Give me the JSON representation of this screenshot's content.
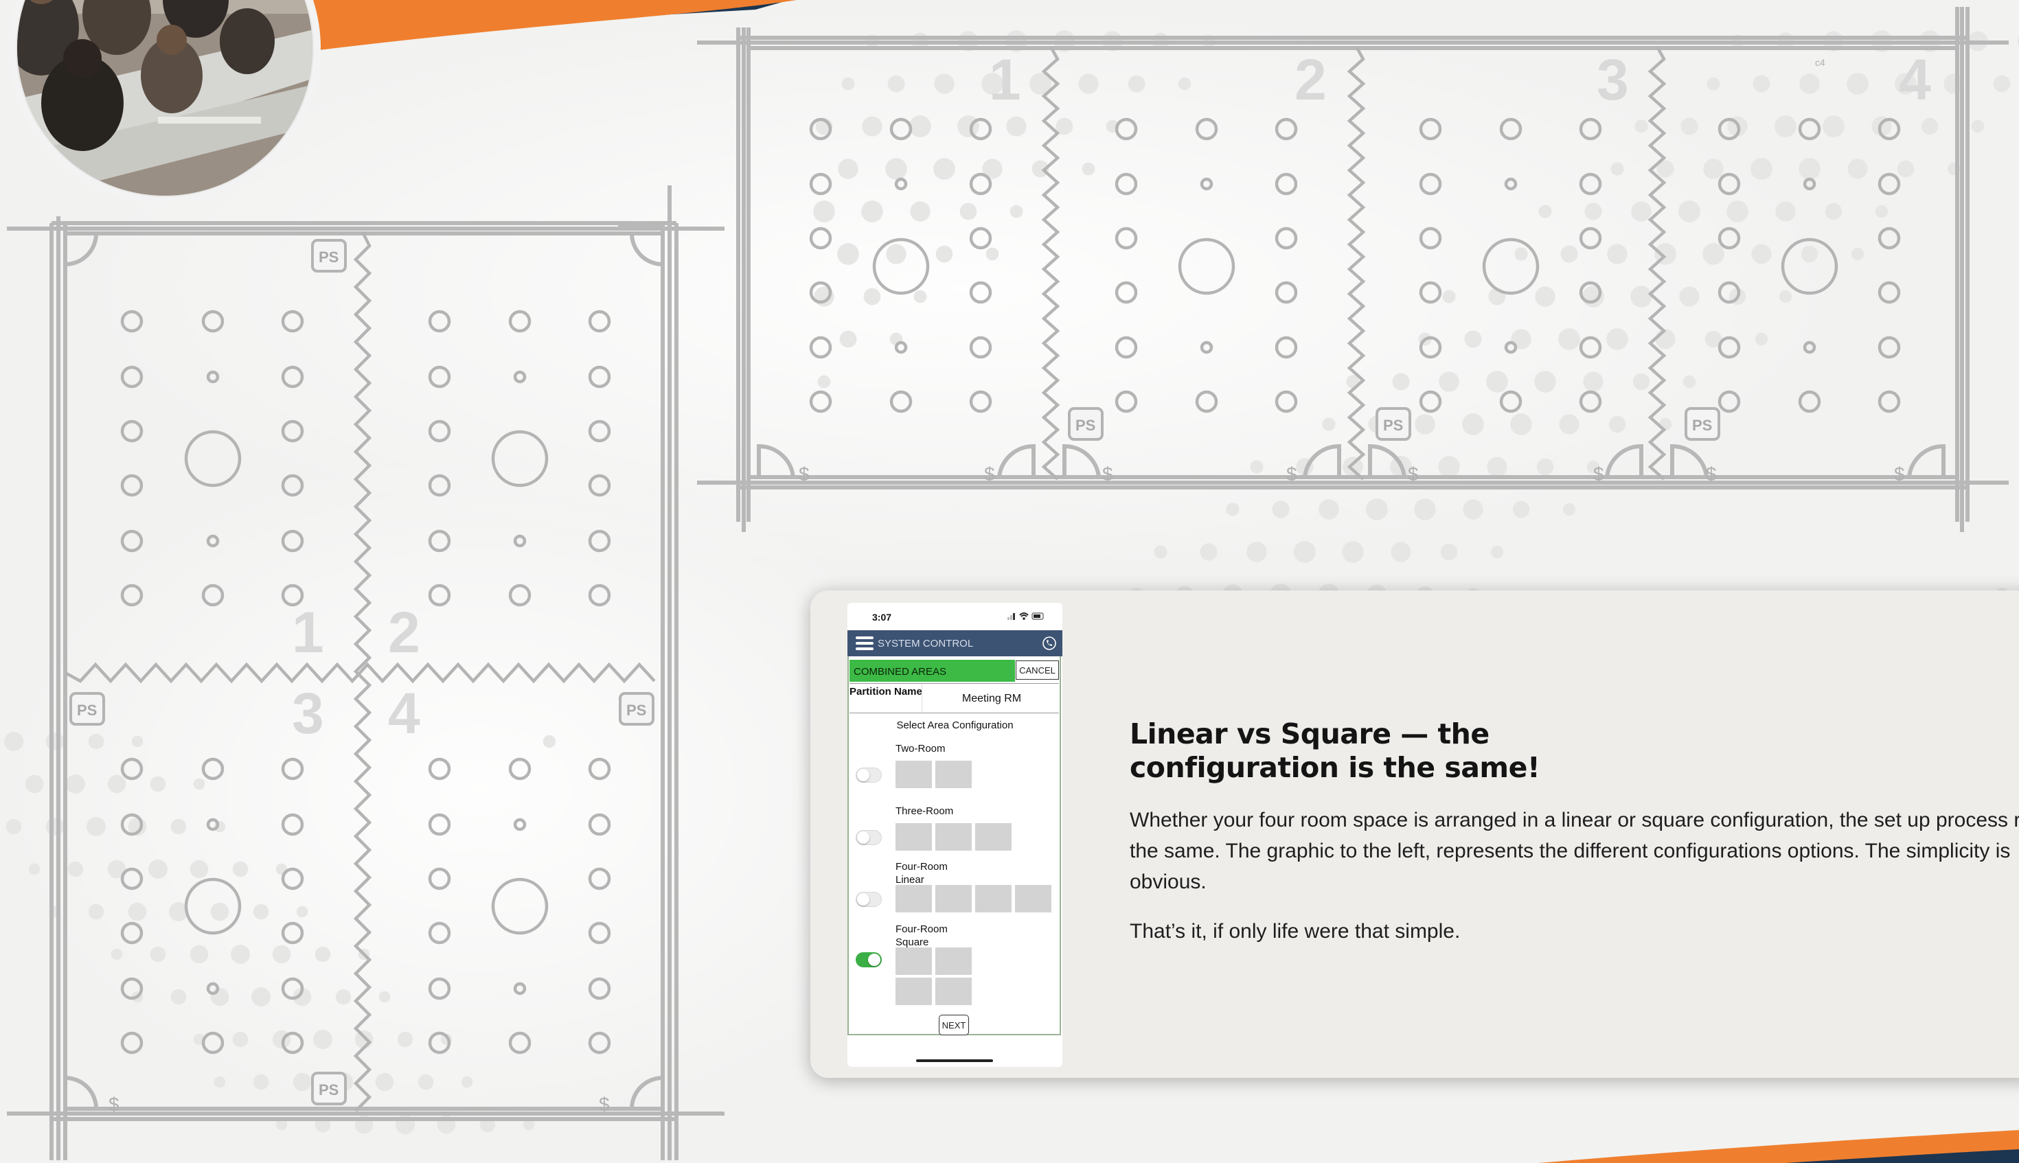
{
  "brand_colors": {
    "orange": "#ef7f2e",
    "navy": "#1c3551",
    "green_toggle": "#3cae46",
    "header_blue": "#3d5373"
  },
  "square_layout": {
    "room_numbers": [
      "1",
      "2",
      "3",
      "4"
    ],
    "ps_label": "PS",
    "outlet_symbol": "$"
  },
  "linear_layout": {
    "room_numbers": [
      "1",
      "2",
      "3",
      "4"
    ],
    "ps_label": "PS",
    "outlet_symbol": "$",
    "corner_note": "c4"
  },
  "card": {
    "heading_line1": "Linear vs Square — the",
    "heading_line2": "configuration is the same!",
    "paragraph1": "Whether your four room space is arranged in a linear or square configuration, the set up process remains the same. The graphic to the left, represents the different configurations options. The simplicity is obvious.",
    "paragraph2": "That’s it, if only life were that simple."
  },
  "phone": {
    "time": "3:07",
    "app_title": "SYSTEM CONTROL",
    "combined_label": "COMBINED AREAS",
    "cancel_label": "CANCEL",
    "partition_label": "Partition Name",
    "partition_value": "Meeting RM",
    "select_label": "Select Area Configuration",
    "options": [
      {
        "label": "Two-Room",
        "selected": false,
        "rooms": 2
      },
      {
        "label": "Three-Room",
        "selected": false,
        "rooms": 3
      },
      {
        "label": "Four-Room Linear",
        "selected": false,
        "rooms": 4
      },
      {
        "label": "Four-Room Square",
        "selected": true,
        "rooms": 4
      }
    ],
    "next_label": "NEXT"
  }
}
